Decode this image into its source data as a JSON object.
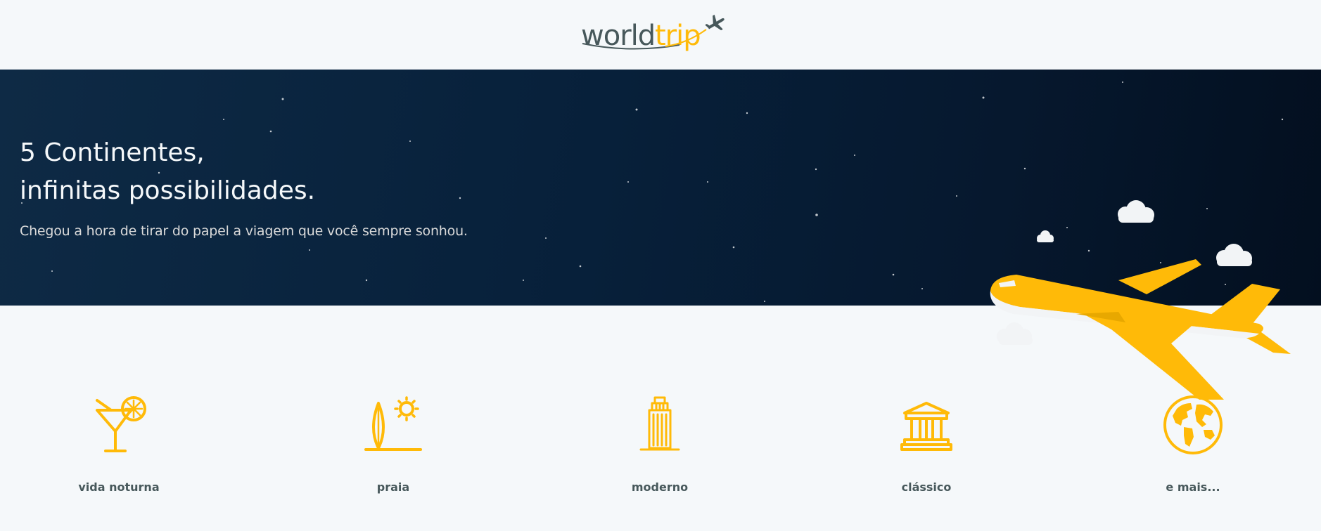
{
  "header": {
    "logo_world": "world",
    "logo_trip": "trip",
    "logo_icon": "airplane-icon"
  },
  "hero": {
    "title_line1": "5 Continentes,",
    "title_line2": "infinitas possibilidades.",
    "subtitle": "Chegou a hora de tirar do papel a viagem que você sempre sonhou.",
    "illustration": "airplane-with-clouds"
  },
  "categories": [
    {
      "label": "vida noturna",
      "icon": "cocktail-icon"
    },
    {
      "label": "praia",
      "icon": "surfboard-sun-icon"
    },
    {
      "label": "moderno",
      "icon": "skyscraper-icon"
    },
    {
      "label": "clássico",
      "icon": "museum-icon"
    },
    {
      "label": "e mais...",
      "icon": "globe-icon"
    }
  ],
  "colors": {
    "accent": "#ffba08",
    "text_dark": "#47585b",
    "background": "#f5f8fa",
    "hero_bg": "#07203a",
    "hero_text": "#f5f8fa"
  }
}
